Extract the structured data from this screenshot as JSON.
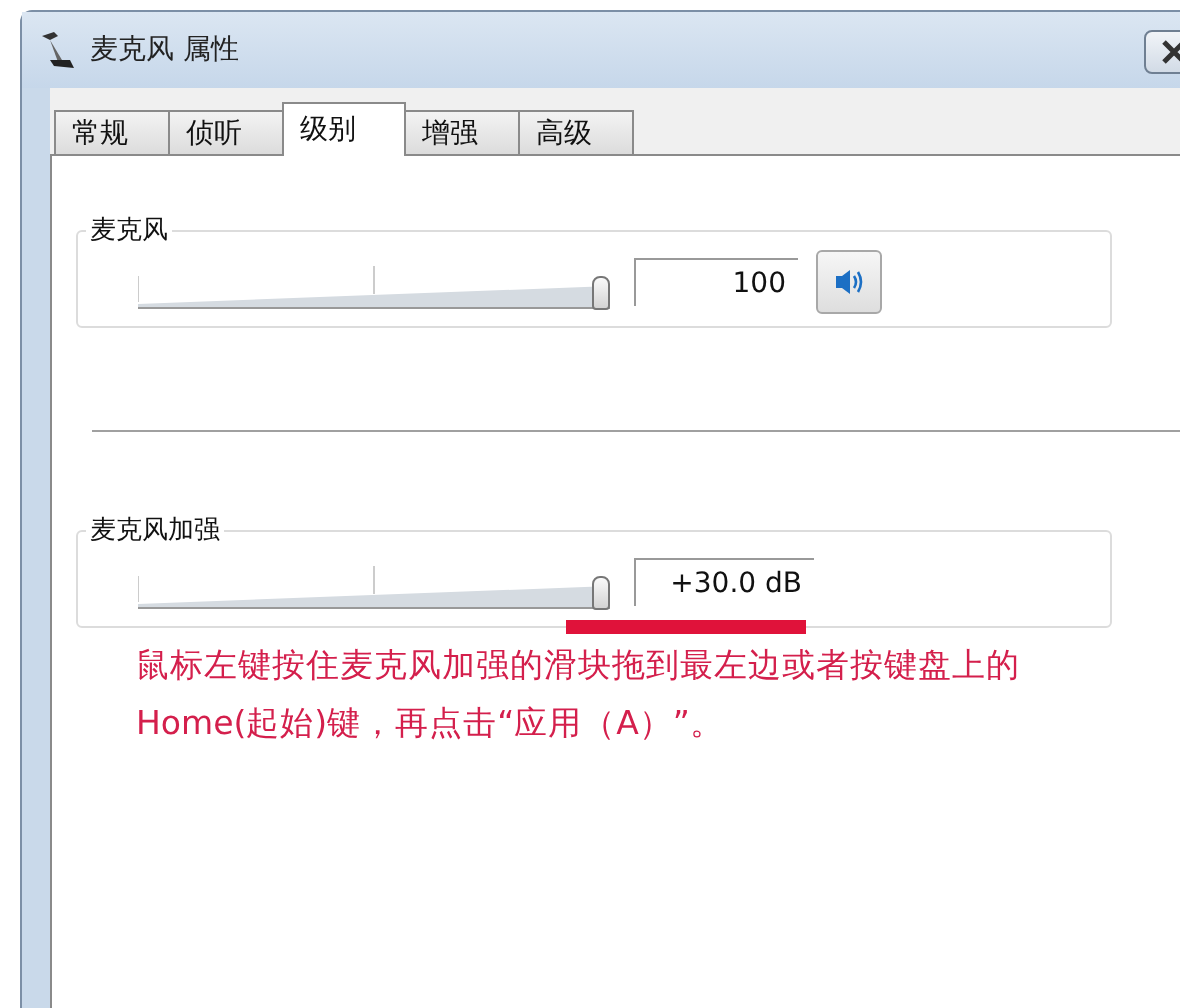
{
  "window": {
    "title": "麦克风 属性"
  },
  "tabs": [
    {
      "label": "常规",
      "selected": false
    },
    {
      "label": "侦听",
      "selected": false
    },
    {
      "label": "级别",
      "selected": true
    },
    {
      "label": "增强",
      "selected": false
    },
    {
      "label": "高级",
      "selected": false
    }
  ],
  "groups": [
    {
      "label": "麦克风",
      "level": 1,
      "value": "100",
      "speaker_button": true,
      "highlighted": false
    },
    {
      "label": "麦克风加强",
      "level": 1,
      "value": "+30.0 dB",
      "speaker_button": false,
      "highlighted": true
    }
  ],
  "annotation": [
    "鼠标左键按住麦克风加强的滑块拖到最左边或者按键盘上的",
    "Home(起始)键，再点击“应用（A）”。"
  ]
}
